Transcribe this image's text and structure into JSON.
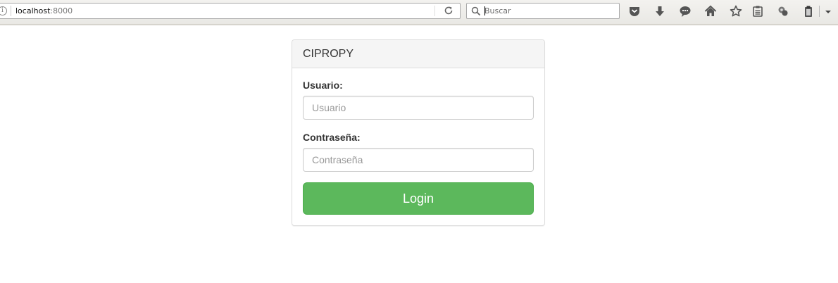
{
  "browser": {
    "url_host": "localhost",
    "url_port": ":8000",
    "search_placeholder": "Buscar",
    "toolbar_icons": [
      "pocket-icon",
      "download-icon",
      "chat-icon",
      "home-icon",
      "bookmark-star-icon",
      "reader-list-icon",
      "extension-icon",
      "clipboard-icon",
      "menu-chevron-icon"
    ]
  },
  "login": {
    "title": "CIPROPY",
    "username_label": "Usuario:",
    "username_placeholder": "Usuario",
    "username_value": "",
    "password_label": "Contraseña:",
    "password_placeholder": "Contraseña",
    "password_value": "",
    "submit_label": "Login"
  },
  "colors": {
    "button_green": "#5cb85c",
    "panel_heading_bg": "#f5f5f5",
    "panel_border": "#dddddd"
  }
}
